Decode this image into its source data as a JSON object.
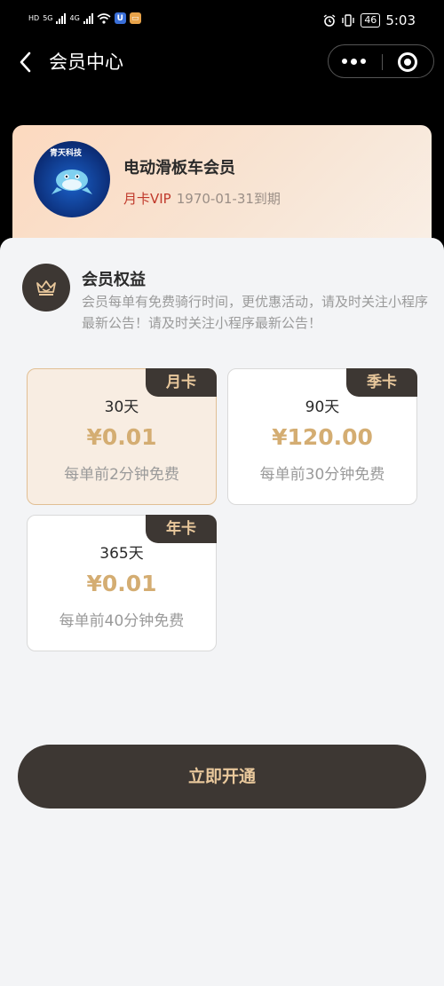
{
  "status_bar": {
    "left_tags": [
      "HD",
      "5G",
      "4G"
    ],
    "time": "5:03",
    "battery": "46"
  },
  "nav": {
    "title": "会员中心"
  },
  "member_card": {
    "avatar_brand": "青天科技",
    "title": "电动滑板车会员",
    "vip_type": "月卡VIP",
    "expire": "1970-01-31到期"
  },
  "benefits": {
    "title": "会员权益",
    "description": "会员每单有免费骑行时间，更优惠活动，请及时关注小程序最新公告！请及时关注小程序最新公告！"
  },
  "plans": [
    {
      "badge": "月卡",
      "days": "30天",
      "price": "¥0.01",
      "note": "每单前2分钟免费"
    },
    {
      "badge": "季卡",
      "days": "90天",
      "price": "¥120.00",
      "note": "每单前30分钟免费"
    },
    {
      "badge": "年卡",
      "days": "365天",
      "price": "¥0.01",
      "note": "每单前40分钟免费"
    }
  ],
  "selected_plan": 0,
  "open_button": "立即开通",
  "colors": {
    "dark": "#3d3733",
    "gold": "#d4ad72",
    "badge_text": "#e9c89c",
    "vip_red": "#c0392b"
  }
}
